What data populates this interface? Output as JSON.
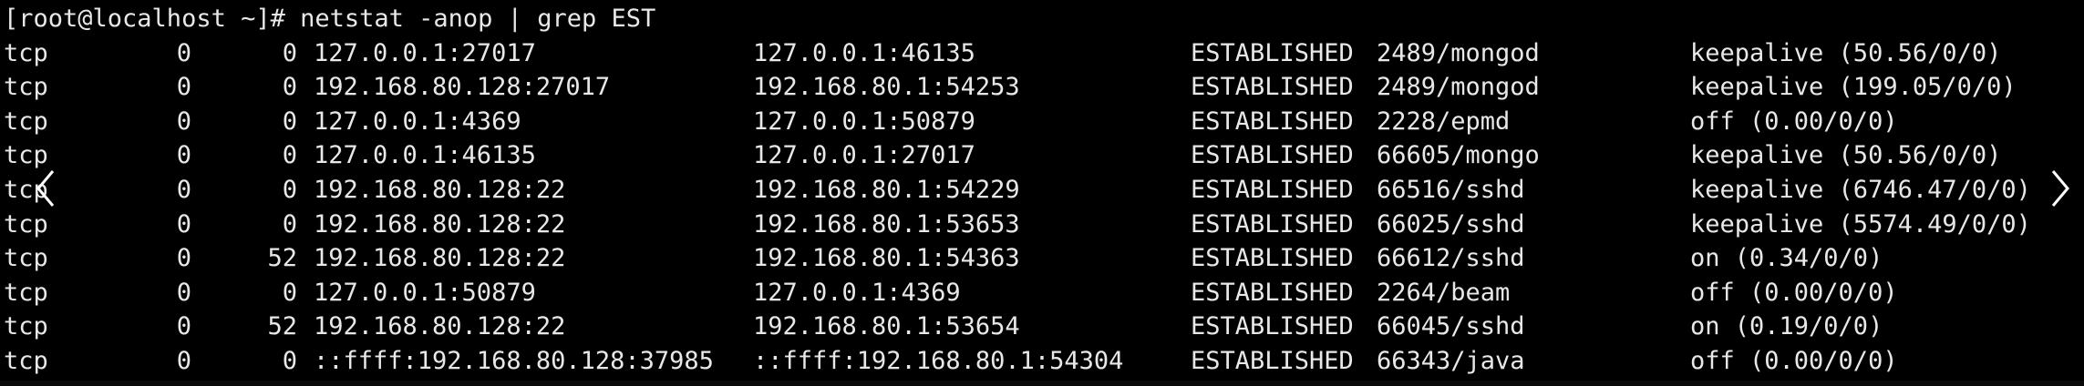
{
  "terminal": {
    "prompt": "[root@localhost ~]# ",
    "command": "netstat -anop | grep EST",
    "rows": [
      {
        "proto": "tcp",
        "recv_q": "0",
        "send_q": "0",
        "local": "127.0.0.1:27017",
        "foreign": "127.0.0.1:46135",
        "state": "ESTABLISHED",
        "pid": "2489/mongod",
        "timer": "keepalive (50.56/0/0)"
      },
      {
        "proto": "tcp",
        "recv_q": "0",
        "send_q": "0",
        "local": "192.168.80.128:27017",
        "foreign": "192.168.80.1:54253",
        "state": "ESTABLISHED",
        "pid": "2489/mongod",
        "timer": "keepalive (199.05/0/0)"
      },
      {
        "proto": "tcp",
        "recv_q": "0",
        "send_q": "0",
        "local": "127.0.0.1:4369",
        "foreign": "127.0.0.1:50879",
        "state": "ESTABLISHED",
        "pid": "2228/epmd",
        "timer": "off (0.00/0/0)"
      },
      {
        "proto": "tcp",
        "recv_q": "0",
        "send_q": "0",
        "local": "127.0.0.1:46135",
        "foreign": "127.0.0.1:27017",
        "state": "ESTABLISHED",
        "pid": "66605/mongo",
        "timer": "keepalive (50.56/0/0)"
      },
      {
        "proto": "tcp",
        "recv_q": "0",
        "send_q": "0",
        "local": "192.168.80.128:22",
        "foreign": "192.168.80.1:54229",
        "state": "ESTABLISHED",
        "pid": "66516/sshd",
        "timer": "keepalive (6746.47/0/0)"
      },
      {
        "proto": "tcp",
        "recv_q": "0",
        "send_q": "0",
        "local": "192.168.80.128:22",
        "foreign": "192.168.80.1:53653",
        "state": "ESTABLISHED",
        "pid": "66025/sshd",
        "timer": "keepalive (5574.49/0/0)"
      },
      {
        "proto": "tcp",
        "recv_q": "0",
        "send_q": "52",
        "local": "192.168.80.128:22",
        "foreign": "192.168.80.1:54363",
        "state": "ESTABLISHED",
        "pid": "66612/sshd",
        "timer": "on (0.34/0/0)"
      },
      {
        "proto": "tcp",
        "recv_q": "0",
        "send_q": "0",
        "local": "127.0.0.1:50879",
        "foreign": "127.0.0.1:4369",
        "state": "ESTABLISHED",
        "pid": "2264/beam",
        "timer": "off (0.00/0/0)"
      },
      {
        "proto": "tcp",
        "recv_q": "0",
        "send_q": "52",
        "local": "192.168.80.128:22",
        "foreign": "192.168.80.1:53654",
        "state": "ESTABLISHED",
        "pid": "66045/sshd",
        "timer": "on (0.19/0/0)"
      },
      {
        "proto": "tcp",
        "recv_q": "0",
        "send_q": "0",
        "local": "::ffff:192.168.80.128:37985",
        "foreign": "::ffff:192.168.80.1:54304",
        "state": "ESTABLISHED",
        "pid": "66343/java",
        "timer": "off (0.00/0/0)"
      }
    ]
  },
  "nav": {
    "prev_icon": "chevron-left-icon",
    "next_icon": "chevron-right-icon"
  },
  "colors": {
    "background": "#000000",
    "text": "#e8e8e8"
  }
}
